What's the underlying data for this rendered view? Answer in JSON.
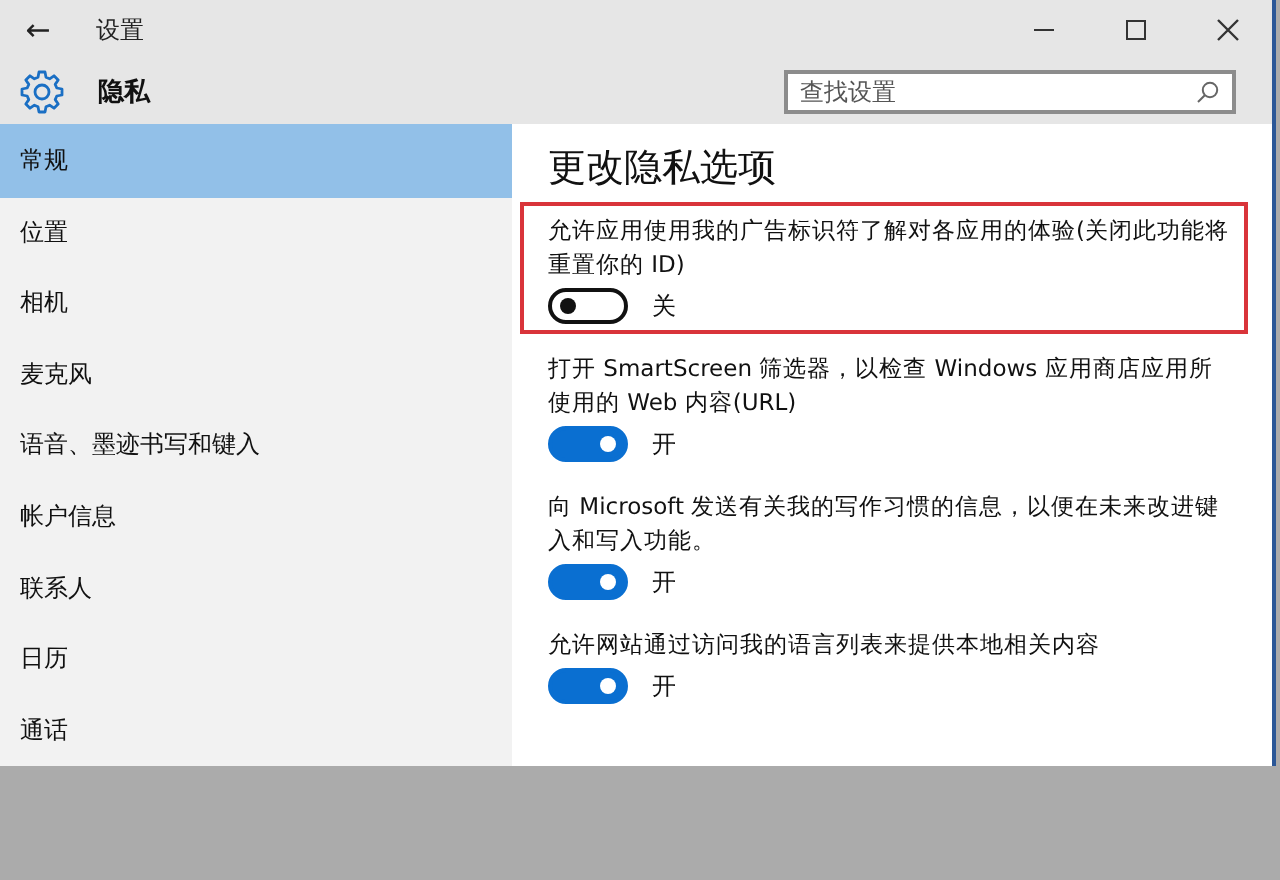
{
  "window": {
    "title": "设置",
    "back": "←"
  },
  "header": {
    "title": "隐私"
  },
  "search": {
    "placeholder": "查找设置"
  },
  "sidebar": {
    "items": [
      {
        "label": "常规",
        "selected": true
      },
      {
        "label": "位置",
        "selected": false
      },
      {
        "label": "相机",
        "selected": false
      },
      {
        "label": "麦克风",
        "selected": false
      },
      {
        "label": "语音、墨迹书写和键入",
        "selected": false
      },
      {
        "label": "帐户信息",
        "selected": false
      },
      {
        "label": "联系人",
        "selected": false
      },
      {
        "label": "日历",
        "selected": false
      },
      {
        "label": "通话",
        "selected": false
      }
    ]
  },
  "content": {
    "title": "更改隐私选项",
    "options": [
      {
        "text": "允许应用使用我的广告标识符了解对各应用的体验(关闭此功能将重置你的 ID)",
        "on": false,
        "state_label": "关",
        "highlighted": true
      },
      {
        "text": "打开 SmartScreen 筛选器，以检查 Windows 应用商店应用所使用的 Web 内容(URL)",
        "on": true,
        "state_label": "开",
        "highlighted": false
      },
      {
        "text": "向 Microsoft 发送有关我的写作习惯的信息，以便在未来改进键入和写入功能。",
        "on": true,
        "state_label": "开",
        "highlighted": false
      },
      {
        "text": "允许网站通过访问我的语言列表来提供本地相关内容",
        "on": true,
        "state_label": "开",
        "highlighted": false
      }
    ]
  }
}
